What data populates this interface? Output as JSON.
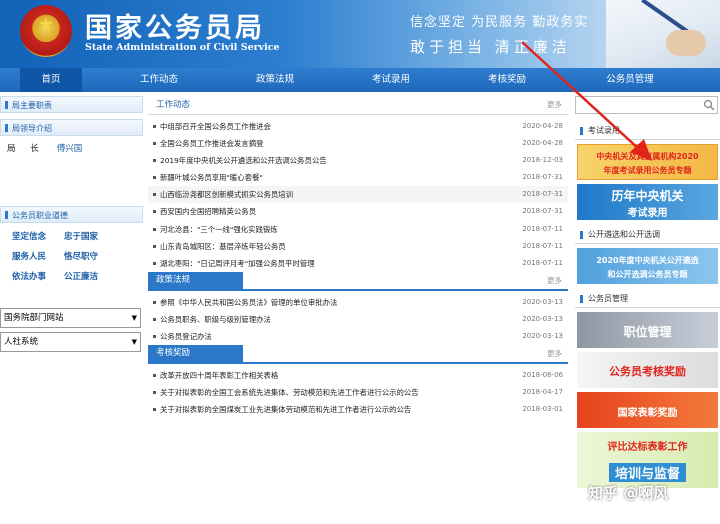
{
  "header": {
    "title": "国家公务员局",
    "subtitle": "State Administration of Civil Service",
    "slogan_line1": "信念坚定  为民服务  勤政务实",
    "slogan_line2": "敢于担当   清正廉洁"
  },
  "nav": {
    "items": [
      "首页",
      "工作动态",
      "政策法规",
      "考试录用",
      "考核奖励",
      "公务员管理"
    ]
  },
  "left": {
    "duties_title": "局主要职责",
    "leaders_title": "局领导介绍",
    "leader_role": "局  长",
    "leader_name": "傅兴国",
    "ethics_title": "公务员职业道德",
    "ethics": [
      "坚定信念",
      "忠于国家",
      "服务人民",
      "恪尽职守",
      "依法办事",
      "公正廉洁"
    ],
    "select1": "国务院部门网站",
    "select2": "人社系统"
  },
  "center": {
    "more_label": "更多",
    "section1_title": "工作动态",
    "section1_items": [
      {
        "text": "中组部召开全国公务员工作推进会",
        "date": "2020-04-28"
      },
      {
        "text": "全国公务员工作推进会发言摘登",
        "date": "2020-04-28"
      },
      {
        "text": "2019年度中央机关公开遴选和公开选调公务员公告",
        "date": "2018-12-03"
      },
      {
        "text": "新疆叶城公务员享用\"暖心套餐\"",
        "date": "2018-07-31"
      },
      {
        "text": "山西临汾尧都区创新模式抓实公务员培训",
        "date": "2018-07-31"
      },
      {
        "text": "西安国内全国招聘精英公务员",
        "date": "2018-07-31"
      },
      {
        "text": "河北沧县：\"三个一线\"强化实践锻炼",
        "date": "2018-07-11"
      },
      {
        "text": "山东青岛城阳区：基层淬炼年轻公务员",
        "date": "2018-07-11"
      },
      {
        "text": "湖北枣阳：\"日记周评月考\"加强公务员平时管理",
        "date": "2018-07-11"
      }
    ],
    "section2_title": "政策法规",
    "section2_items": [
      {
        "text": "参照《中华人民共和国公务员法》管理的单位审批办法",
        "date": "2020-03-13"
      },
      {
        "text": "公务员职务、职级与级别管理办法",
        "date": "2020-03-13"
      },
      {
        "text": "公务员登记办法",
        "date": "2020-03-13"
      }
    ],
    "section3_title": "考核奖励",
    "section3_items": [
      {
        "text": "改革开放四十周年表彰工作相关表格",
        "date": "2018-06-06"
      },
      {
        "text": "关于对拟表彰的全国工会系统先进集体、劳动模范和先进工作者进行公示的公告",
        "date": "2018-04-17"
      },
      {
        "text": "关于对拟表彰的全国煤炭工业先进集体劳动模范和先进工作者进行公示的公告",
        "date": "2018-03-01"
      }
    ]
  },
  "right": {
    "exam_title": "考试录用",
    "banner1_line1": "中央机关及其直属机构2020",
    "banner1_line2": "年度考试录用公务员专题",
    "banner2_line1": "历年中央机关",
    "banner2_line2": "考试录用",
    "transfer_title": "公开遴选和公开选调",
    "banner3_line1": "2020年度中央机关公开遴选",
    "banner3_line2": "和公开选调公务员专题",
    "mgmt_title": "公务员管理",
    "banner4": "职位管理",
    "banner5": "公务员考核奖励",
    "banner6": "国家表彰奖励",
    "banner7_line1": "评比达标表彰工作",
    "banner7_line2": "培训与监督"
  },
  "watermark": "知乎 @啊风",
  "colors": {
    "brand_blue": "#1d68bb",
    "link_blue": "#1d5fa8",
    "annotation_red": "#e0231b"
  }
}
